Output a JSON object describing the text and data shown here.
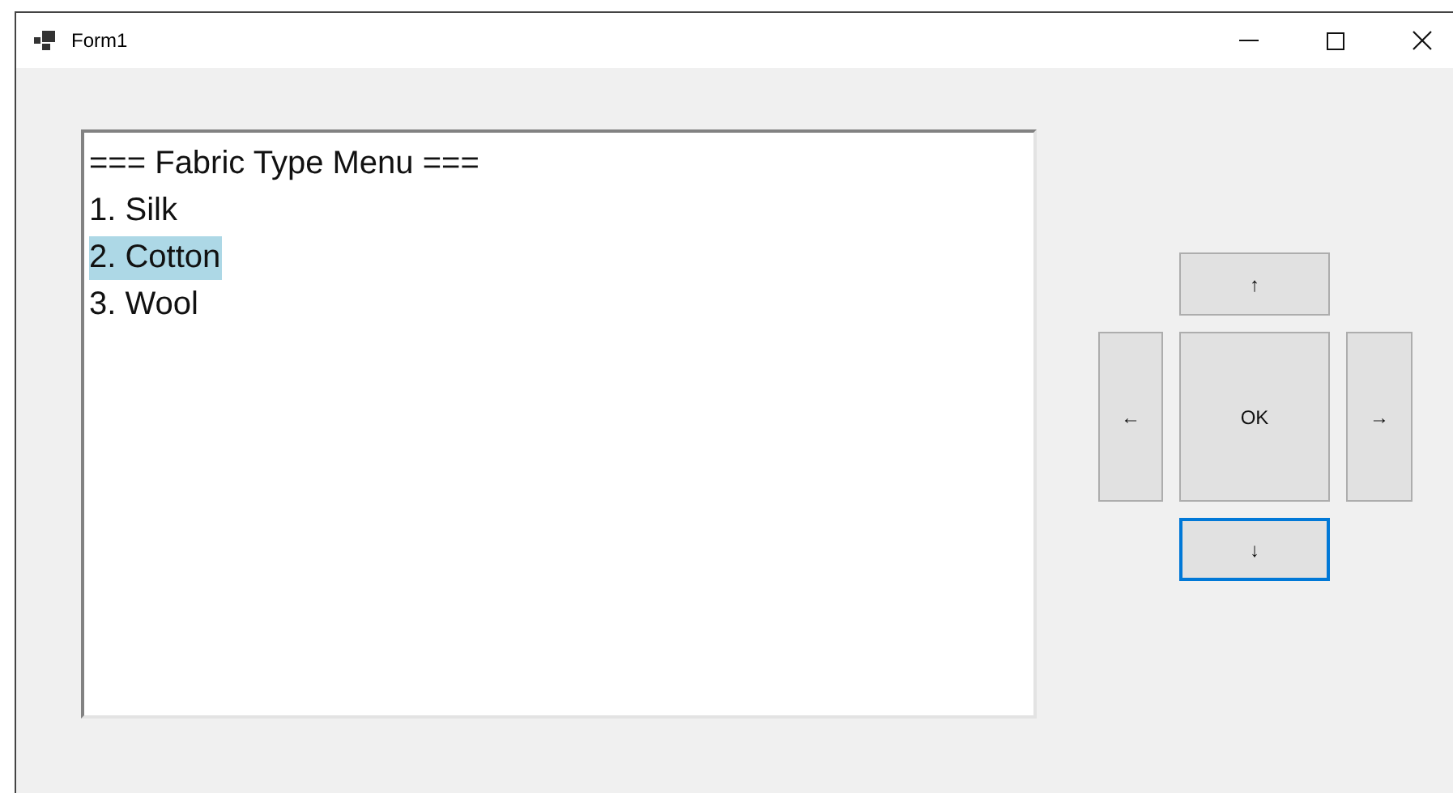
{
  "window": {
    "title": "Form1"
  },
  "listbox": {
    "items": [
      {
        "text": "=== Fabric Type Menu ===",
        "selected": false
      },
      {
        "text": "1. Silk",
        "selected": false
      },
      {
        "text": "2. Cotton",
        "selected": true
      },
      {
        "text": "3. Wool",
        "selected": false
      }
    ]
  },
  "buttons": [
    {
      "kind": "up",
      "label": "↑",
      "focused": false
    },
    {
      "kind": "left",
      "label": "←",
      "focused": false
    },
    {
      "kind": "ok",
      "label": "OK",
      "focused": false
    },
    {
      "kind": "right",
      "label": "→",
      "focused": false
    },
    {
      "kind": "down",
      "label": "↓",
      "focused": true
    }
  ]
}
